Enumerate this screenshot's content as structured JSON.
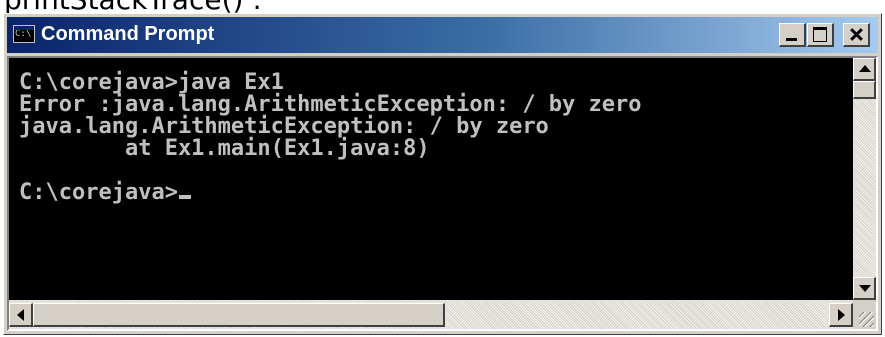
{
  "caption": "printStackTrace() :",
  "window": {
    "title": "Command Prompt",
    "icon": "console-app-icon",
    "icon_text": "C:\\",
    "controls": [
      "minimize-icon",
      "maximize-icon",
      "close-icon"
    ]
  },
  "console": {
    "lines": [
      "C:\\corejava>java Ex1",
      "Error :java.lang.ArithmeticException: / by zero",
      "java.lang.ArithmeticException: / by zero",
      "        at Ex1.main(Ex1.java:8)",
      "",
      "C:\\corejava>"
    ],
    "text_color": "#c0c0c0",
    "background_color": "#000000"
  },
  "scrollbars": {
    "vertical": "visible",
    "horizontal": "visible"
  },
  "colors": {
    "titlebar_start": "#0a246a",
    "titlebar_end": "#a6caf0",
    "chrome": "#d4d0c8"
  }
}
